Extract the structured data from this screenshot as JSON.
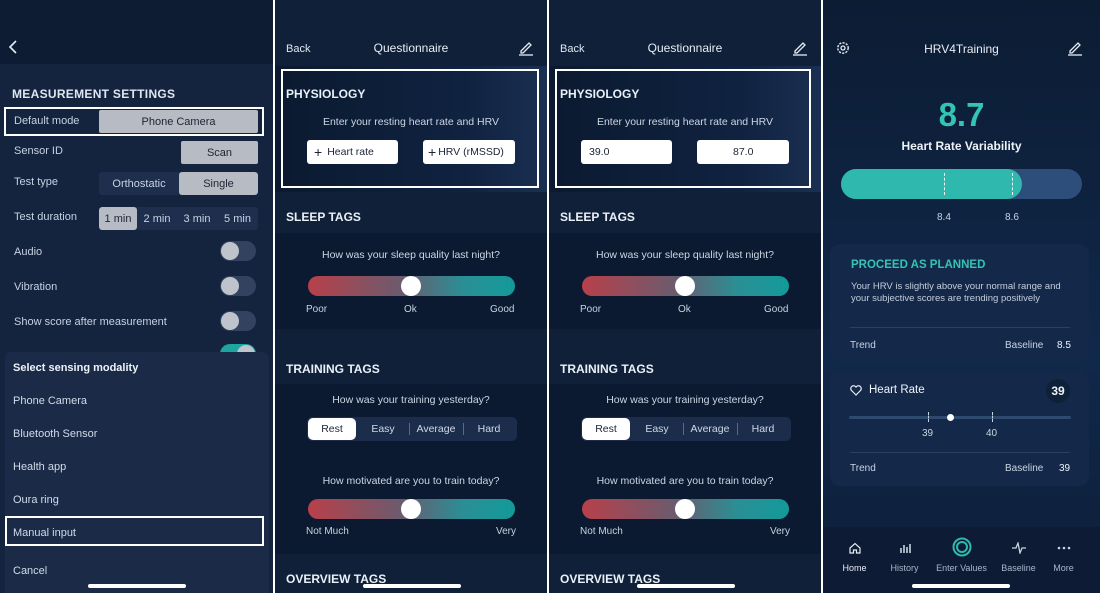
{
  "panel1": {
    "section_title": "MEASUREMENT SETTINGS",
    "rows": {
      "default_mode": {
        "label": "Default mode",
        "value": "Phone Camera"
      },
      "sensor_id": {
        "label": "Sensor ID",
        "button": "Scan"
      },
      "test_type": {
        "label": "Test type",
        "options": [
          "Orthostatic",
          "Single"
        ],
        "selected": "Single"
      },
      "test_duration": {
        "label": "Test duration",
        "options": [
          "1 min",
          "2 min",
          "3 min",
          "5 min"
        ],
        "selected": "1 min"
      },
      "audio": {
        "label": "Audio",
        "on": false
      },
      "vibration": {
        "label": "Vibration",
        "on": false
      },
      "show_score": {
        "label": "Show score after measurement",
        "on": false
      }
    },
    "sheet": {
      "title": "Select sensing modality",
      "items": [
        "Phone Camera",
        "Bluetooth Sensor",
        "Health app",
        "Oura ring",
        "Manual input"
      ],
      "selected": "Manual input",
      "cancel": "Cancel"
    }
  },
  "questionnaire": {
    "back": "Back",
    "title": "Questionnaire",
    "physiology_title": "PHYSIOLOGY",
    "physiology_prompt": "Enter your resting heart rate and HRV",
    "heart_rate_placeholder": "Heart rate",
    "hrv_placeholder": "HRV (rMSSD)",
    "heart_rate_value": "39.0",
    "hrv_value": "87.0",
    "sleep_title": "SLEEP TAGS",
    "sleep_question": "How was your sleep quality last night?",
    "sleep_labels": [
      "Poor",
      "Ok",
      "Good"
    ],
    "sleep_level": 0.5,
    "training_title": "TRAINING TAGS",
    "training_question": "How was your training yesterday?",
    "training_options": [
      "Rest",
      "Easy",
      "Average",
      "Hard"
    ],
    "training_selected": "Rest",
    "motivation_question": "How motivated are you to train today?",
    "motivation_labels": [
      "Not Much",
      "Very"
    ],
    "motivation_level": 0.5,
    "overview_title": "OVERVIEW TAGS"
  },
  "panel4": {
    "title": "HRV4Training",
    "hrv_value": "8.7",
    "hrv_label": "Heart Rate Variability",
    "range_low": "8.4",
    "range_high": "8.6",
    "advice_title": "PROCEED AS PLANNED",
    "advice_text": "Your HRV is slightly above your normal range and your subjective scores are trending positively",
    "trend_label": "Trend",
    "baseline_label": "Baseline",
    "hrv_baseline": "8.5",
    "hr_title": "Heart Rate",
    "hr_value": "39",
    "hr_range_low": "39",
    "hr_range_high": "40",
    "hr_baseline": "39",
    "nav": [
      "Home",
      "History",
      "Enter Values",
      "Baseline",
      "More"
    ],
    "nav_active": "Home",
    "accent": "#2fb8ad"
  }
}
